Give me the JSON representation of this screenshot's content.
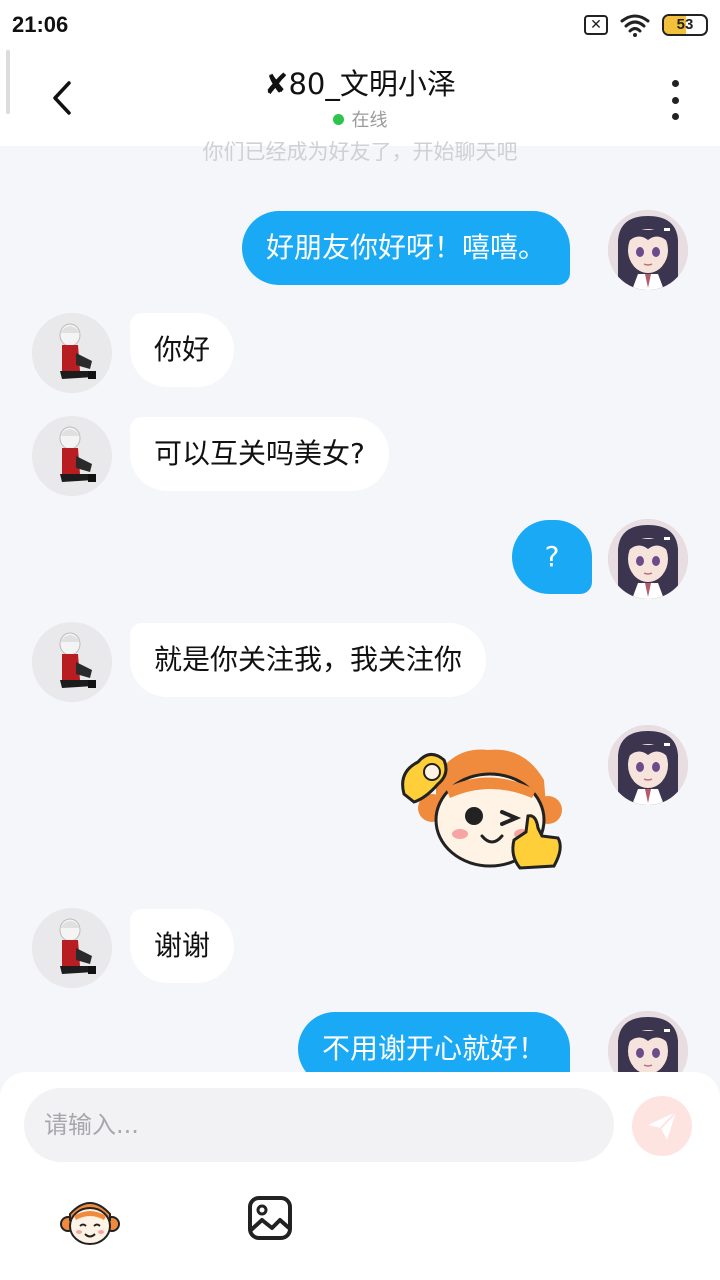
{
  "status_bar": {
    "time": "21:06",
    "battery_level": "53",
    "battery_fraction": 0.53,
    "icons": [
      "sim-x-icon",
      "wifi-icon",
      "battery-icon"
    ]
  },
  "header": {
    "title_prefix": "✘",
    "title": "80_文明小泽",
    "status": "在线",
    "status_color": "#2cc44a",
    "icons": [
      "back-chevron-icon",
      "more-vertical-icon"
    ]
  },
  "chat": {
    "system_note": "你们已经成为好友了，开始聊天吧",
    "messages": [
      {
        "from": "me",
        "type": "text",
        "text": "好朋友你好呀！嘻嘻。"
      },
      {
        "from": "other",
        "type": "text",
        "text": "你好"
      },
      {
        "from": "other",
        "type": "text",
        "text": "可以互关吗美女?"
      },
      {
        "from": "me",
        "type": "text",
        "text": "?"
      },
      {
        "from": "other",
        "type": "text",
        "text": "就是你关注我，我关注你"
      },
      {
        "from": "me",
        "type": "sticker",
        "sticker": "monkey-wink-thumbs-up-sticker"
      },
      {
        "from": "other",
        "type": "text",
        "text": "谢谢"
      },
      {
        "from": "me",
        "type": "text",
        "text": "不用谢开心就好！"
      }
    ],
    "outgoing_bubble_color": "#1aa9f4",
    "incoming_bubble_color": "#ffffff"
  },
  "composer": {
    "placeholder": "请输入...",
    "icons": [
      "send-paper-plane-icon",
      "emoji-monkey-icon",
      "image-picker-icon"
    ]
  }
}
